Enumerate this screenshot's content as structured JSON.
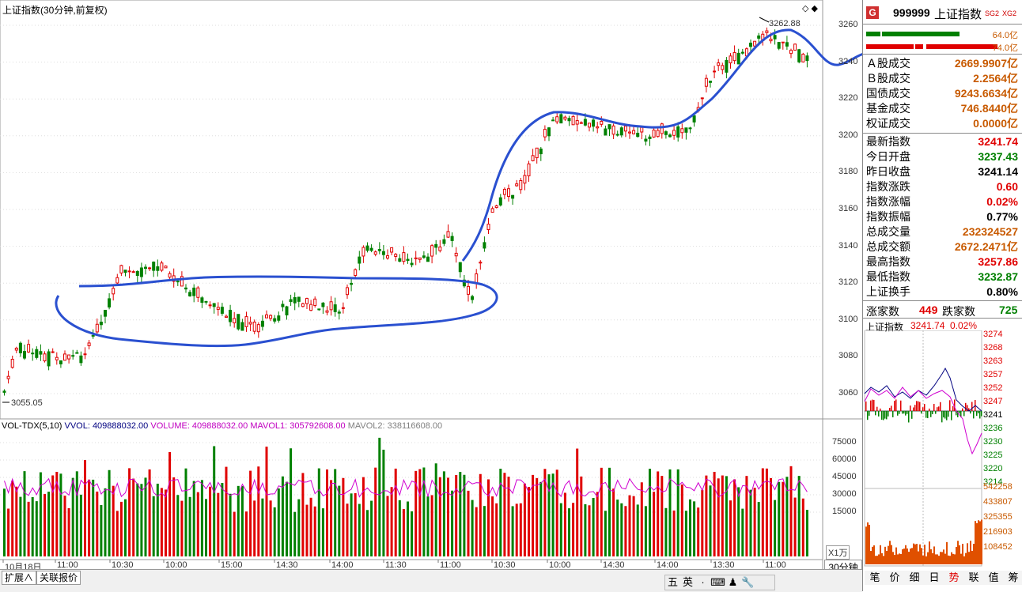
{
  "kline": {
    "title": "上证指数(30分钟,前复权)",
    "peak_label": "3262.88",
    "low_label": "3055.05",
    "y_ticks": [
      "3260",
      "3240",
      "3220",
      "3200",
      "3180",
      "3160",
      "3140",
      "3120",
      "3100",
      "3080",
      "3060"
    ],
    "x_ticks": [
      "10月18日",
      "11:00",
      "10:30",
      "10:00",
      "15:00",
      "14:30",
      "14:00",
      "11:30",
      "11:00",
      "10:30",
      "10:00",
      "14:30",
      "14:00",
      "13:30",
      "11:00"
    ]
  },
  "volume": {
    "header": {
      "name": "VOL-TDX(5,10)",
      "vvol": "VVOL: 409888032.00",
      "volume": "VOLUME: 409888032.00",
      "mavol1": "MAVOL1: 305792608.00",
      "mavol2": "MAVOL2: 338116608.00"
    },
    "y_ticks": [
      "75000",
      "60000",
      "45000",
      "30000",
      "15000"
    ],
    "unit": "X1万",
    "period": "30分钟"
  },
  "bottom_tabs": [
    "扩展∧",
    "关联报价"
  ],
  "ime": [
    "五",
    "英",
    "·",
    "⌨",
    "♟",
    "🔧"
  ],
  "right_panel": {
    "logo": "G",
    "code": "999999",
    "name": "上证指数",
    "badges": [
      "SG2",
      "XG2"
    ],
    "bar1_value": "64.0亿",
    "bar2_value": "74.0亿",
    "turnover": [
      {
        "label": "Ａ股成交",
        "value": "2669.9907亿"
      },
      {
        "label": "Ｂ股成交",
        "value": "2.2564亿"
      },
      {
        "label": "国债成交",
        "value": "9243.6634亿"
      },
      {
        "label": "基金成交",
        "value": "746.8440亿"
      },
      {
        "label": "权证成交",
        "value": "0.0000亿"
      }
    ],
    "stats": [
      {
        "label": "最新指数",
        "value": "3241.74",
        "color": "red"
      },
      {
        "label": "今日开盘",
        "value": "3237.43",
        "color": "green"
      },
      {
        "label": "昨日收盘",
        "value": "3241.14",
        "color": "black"
      },
      {
        "label": "指数涨跌",
        "value": "0.60",
        "color": "red"
      },
      {
        "label": "指数涨幅",
        "value": "0.02%",
        "color": "red"
      },
      {
        "label": "指数振幅",
        "value": "0.77%",
        "color": "black"
      },
      {
        "label": "总成交量",
        "value": "232324527",
        "color": "orange"
      },
      {
        "label": "总成交额",
        "value": "2672.2471亿",
        "color": "orange"
      },
      {
        "label": "最高指数",
        "value": "3257.86",
        "color": "red"
      },
      {
        "label": "最低指数",
        "value": "3232.87",
        "color": "green"
      },
      {
        "label": "上证换手",
        "value": "0.80%",
        "color": "black"
      }
    ],
    "advance_label": "涨家数",
    "advance_value": "449",
    "decline_label": "跌家数",
    "decline_value": "725",
    "mini_title": "上证指数",
    "mini_value": "3241.74",
    "mini_pct": "0.02%",
    "mini_price_ticks": [
      "3274",
      "3268",
      "3263",
      "3257",
      "3252",
      "3247",
      "3241",
      "3236",
      "3230",
      "3225",
      "3220",
      "3214"
    ],
    "mini_vol_ticks": [
      "542258",
      "433807",
      "325355",
      "216903",
      "108452"
    ],
    "side_tabs": [
      "笔",
      "价",
      "细",
      "日",
      "势",
      "联",
      "值",
      "筹"
    ]
  }
}
